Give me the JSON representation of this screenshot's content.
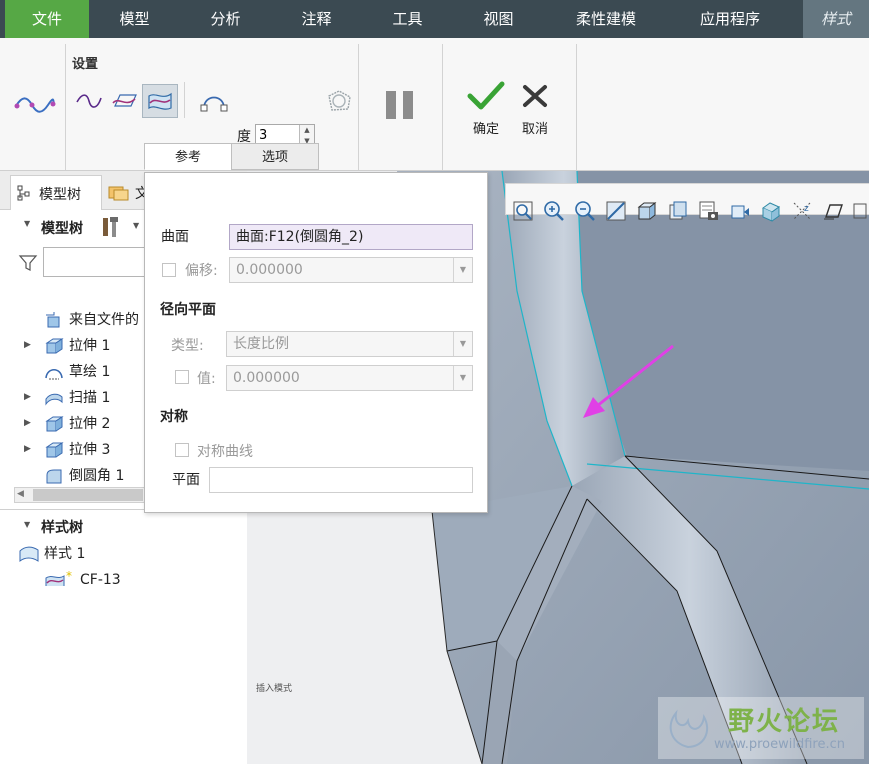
{
  "menu": {
    "items": [
      "文件",
      "模型",
      "分析",
      "注释",
      "工具",
      "视图",
      "柔性建模",
      "应用程序"
    ],
    "context_tab": "样式"
  },
  "ribbon": {
    "group_label": "设置",
    "degree_label": "度",
    "degree_value": "3",
    "ok_label": "确定",
    "cancel_label": "取消",
    "tabs": [
      "参考",
      "选项"
    ]
  },
  "left_panel": {
    "tabs": [
      "模型树",
      "文"
    ],
    "tree_title": "模型树",
    "tree_items": [
      {
        "label": "来自文件的",
        "icon": "import-feature-icon"
      },
      {
        "label": "拉伸 1",
        "icon": "extrude-icon"
      },
      {
        "label": "草绘 1",
        "icon": "sketch-icon"
      },
      {
        "label": "扫描 1",
        "icon": "sweep-icon"
      },
      {
        "label": "拉伸 2",
        "icon": "extrude-icon"
      },
      {
        "label": "拉伸 3",
        "icon": "extrude-icon"
      },
      {
        "label": "倒圆角 1",
        "icon": "round-icon"
      }
    ],
    "style_tree_title": "样式树",
    "style_items": [
      "样式 1",
      "CF-13"
    ]
  },
  "popup": {
    "surface_label": "曲面",
    "surface_value": "曲面:F12(倒圆角_2)",
    "offset_label": "偏移:",
    "offset_value": "0.000000",
    "radial_plane_header": "径向平面",
    "type_label": "类型:",
    "type_value": "长度比例",
    "value_label": "值:",
    "value_value": "0.000000",
    "symmetry_header": "对称",
    "symmetric_curve_label": "对称曲线",
    "plane_label": "平面",
    "plane_value": ""
  },
  "viewport": {
    "insert_mode_text": "插入模式",
    "watermark_title": "野火论坛",
    "watermark_url": "www.proewildfire.cn"
  },
  "colors": {
    "menu_bg": "#3b4a52",
    "file_tab": "#56a845",
    "arrow": "#e040e6",
    "edge_highlight": "#1fb5c9"
  }
}
